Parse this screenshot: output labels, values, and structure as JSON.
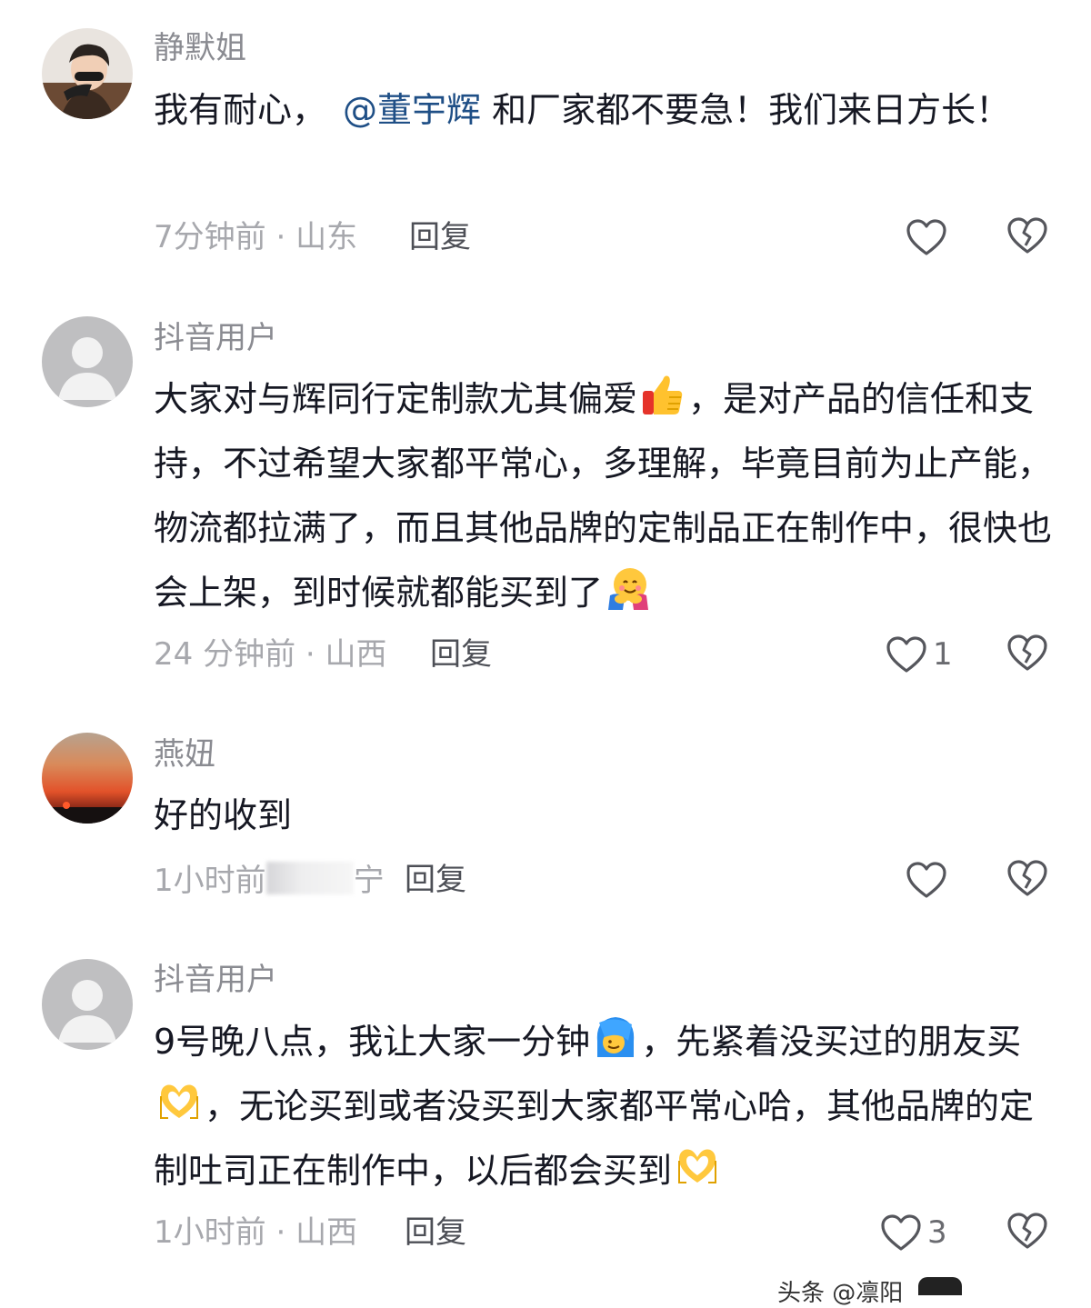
{
  "comments": [
    {
      "username": "静默姐",
      "text_pre": "我有耐心，",
      "mention": "@董宇辉",
      "text_post": " 和厂家都不要急！我们来日方长！",
      "time": "7分钟前",
      "location": "山东",
      "reply_label": "回复",
      "like_count": ""
    },
    {
      "username": "抖音用户",
      "text_a": "大家对与辉同行定制款尤其偏爱",
      "text_b": "，是对产品的信任和支持，不过希望大家都平常心，多理解，毕竟目前为止产能，物流都拉满了，而且其他品牌的定制品正在制作中，很快也会上架，到时候就都能买到了",
      "time": "24 分钟前",
      "location": "山西",
      "reply_label": "回复",
      "like_count": "1"
    },
    {
      "username": "燕妞",
      "text": "好的收到",
      "meta_pre": "1小时前",
      "meta_post": "宁",
      "reply_label": "回复",
      "like_count": ""
    },
    {
      "username": "抖音用户",
      "text_a": "9号晚八点，我让大家一分钟",
      "text_b": "，先紧着没买过的朋友买",
      "text_c": "，无论买到或者没买到大家都平常心哈，其他品牌的定制吐司正在制作中，以后都会买到",
      "time": "1小时前",
      "location": "山西",
      "reply_label": "回复",
      "like_count": "3"
    }
  ],
  "meta_separator": "·",
  "watermark": "头条 @凛阳",
  "icons": {
    "like": "heart-outline-icon",
    "dislike": "broken-heart-icon",
    "emoji_thumbs_up": "thumbs-up-emoji",
    "emoji_hug": "hugging-face-emoji",
    "emoji_hiding": "face-behind-hair-emoji",
    "emoji_heart_hands": "heart-hands-emoji"
  },
  "colors": {
    "username": "#8a8b91",
    "meta": "#a7a8ad",
    "mention": "#1f4f86",
    "text": "#161823"
  }
}
